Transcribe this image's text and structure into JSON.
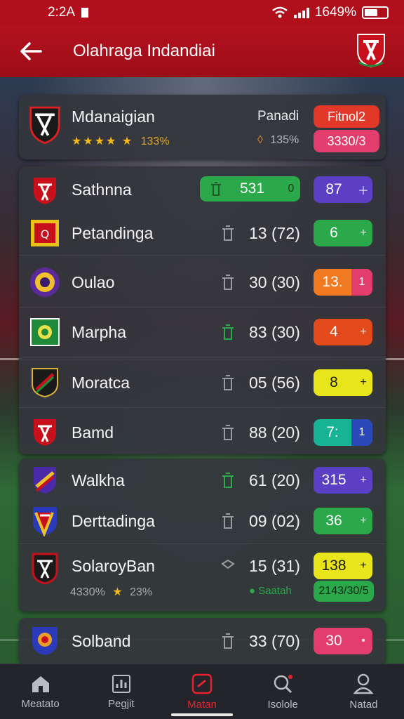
{
  "status_bar": {
    "time": "2:2A",
    "battery": "1649%"
  },
  "header": {
    "title": "Olahraga Indandiai"
  },
  "top_card": {
    "team": "Mdanaigian",
    "rating_stars": "★★★★ ★",
    "rating_pct": "133%",
    "meta_icon_value": "135%",
    "label": "Panadi",
    "badge_red": "Fitnol2",
    "badge_pink": "3330/3"
  },
  "rows_a": [
    {
      "name": "Sathnna",
      "score": "531",
      "score_extra": "0",
      "pill": "87",
      "pill_extra": "＋"
    },
    {
      "name": "Petandinga",
      "score": "13 (72)",
      "pill": "6",
      "pill_extra": "+"
    },
    {
      "name": "Oulao",
      "score": "30 (30)",
      "pill": "13.",
      "pill_extra": "1"
    },
    {
      "name": "Marpha",
      "score": "83 (30)",
      "pill": "4",
      "pill_extra": "+"
    },
    {
      "name": "Moratca",
      "score": "05 (56)",
      "pill": "8",
      "pill_extra": "+"
    },
    {
      "name": "Bamd",
      "score": "88 (20)",
      "pill": "7:",
      "pill_extra": "1"
    }
  ],
  "rows_b": [
    {
      "name": "Walkha",
      "score": "61 (20)",
      "pill": "315",
      "pill_extra": "+"
    },
    {
      "name": "Derttadinga",
      "score": "09 (02)",
      "pill": "36",
      "pill_extra": "+"
    },
    {
      "name": "SolaroyBan",
      "score": "15 (31)",
      "pill": "138",
      "pill_extra": "+",
      "sub_left": "4330%",
      "sub_stars": "★",
      "sub_pct": "23%",
      "sub_right": "Saatah",
      "sub_pill": "2143/30/5"
    }
  ],
  "rows_c": [
    {
      "name": "Solband",
      "score": "33 (70)",
      "pill": "30",
      "pill_extra": "•"
    }
  ],
  "bottom_nav": [
    {
      "label": "Meatato",
      "icon": "home-icon"
    },
    {
      "label": "Pegjit",
      "icon": "chart-icon"
    },
    {
      "label": "Matan",
      "icon": "live-icon"
    },
    {
      "label": "Isolole",
      "icon": "search-icon"
    },
    {
      "label": "Natad",
      "icon": "user-icon"
    }
  ],
  "colors": {
    "brand_red": "#b0101c",
    "green": "#2aa84a",
    "purple": "#5b3fc4",
    "orange": "#ef7a22",
    "orange_red": "#e34b1c",
    "yellow": "#e8e61a",
    "teal": "#16b394",
    "pink": "#e33d6e",
    "active_nav": "#e32430"
  }
}
